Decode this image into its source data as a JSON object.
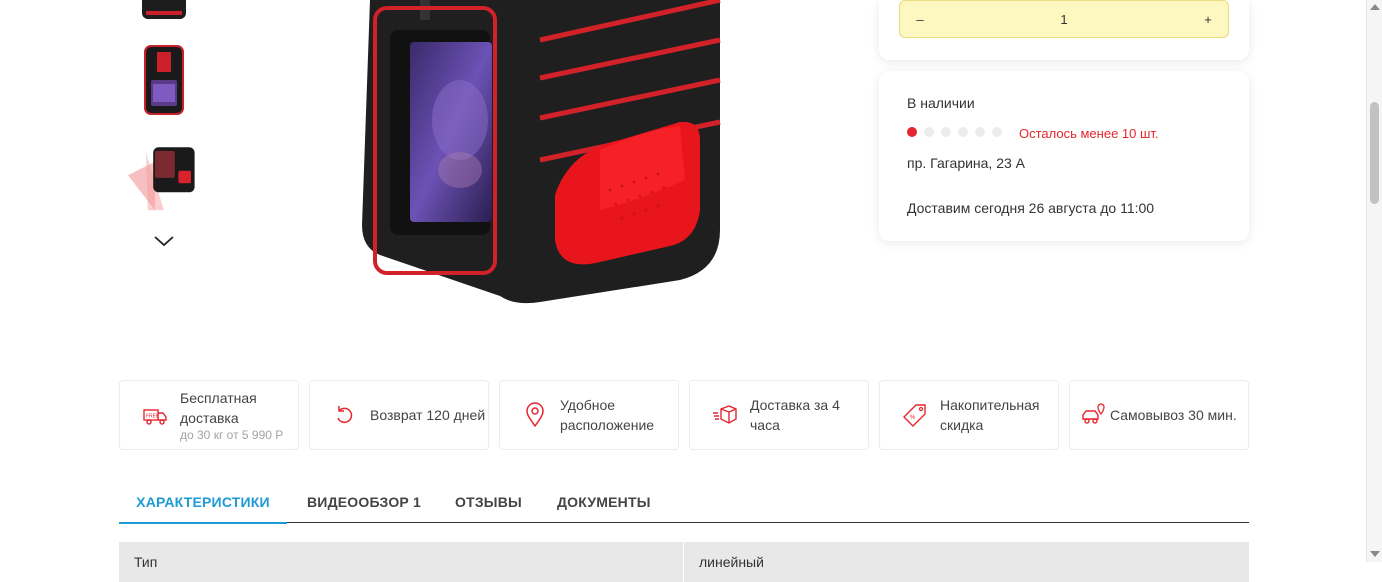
{
  "gallery": {
    "thumbnails": [
      "laser-level-front-thumb",
      "laser-level-side-thumb",
      "laser-level-beam-thumb"
    ],
    "next_icon": "chevron-down-icon"
  },
  "purchase": {
    "qty_minus": "–",
    "qty_value": "1",
    "qty_plus": "+"
  },
  "availability": {
    "title": "В наличии",
    "stock_level": 1,
    "stock_level_max": 6,
    "warning": "Осталось менее 10 шт.",
    "address": "пр. Гагарина, 23 А",
    "delivery": "Доставим сегодня 26 августа до 11:00"
  },
  "features": [
    {
      "icon": "delivery-truck-icon",
      "label": "Бесплатная доставка",
      "sublabel": "до 30 кг от 5 990 Р"
    },
    {
      "icon": "return-arrow-icon",
      "label": "Возврат 120 дней"
    },
    {
      "icon": "location-pin-icon",
      "label": "Удобное расположение"
    },
    {
      "icon": "fast-box-icon",
      "label": "Доставка за 4 часа"
    },
    {
      "icon": "discount-tag-icon",
      "label": "Накопительная скидка"
    },
    {
      "icon": "car-pickup-icon",
      "label": "Самовывоз 30 мин."
    }
  ],
  "tabs": [
    {
      "label": "ХАРАКТЕРИСТИКИ",
      "active": true
    },
    {
      "label": "ВИДЕООБЗОР 1",
      "active": false
    },
    {
      "label": "ОТЗЫВЫ",
      "active": false
    },
    {
      "label": "ДОКУМЕНТЫ",
      "active": false
    }
  ],
  "specs": [
    {
      "name": "Тип",
      "value": "линейный"
    }
  ],
  "colors": {
    "accent": "#e6262e",
    "tab_active": "#1e9ad6",
    "qty_bg": "#fdf8c0"
  }
}
